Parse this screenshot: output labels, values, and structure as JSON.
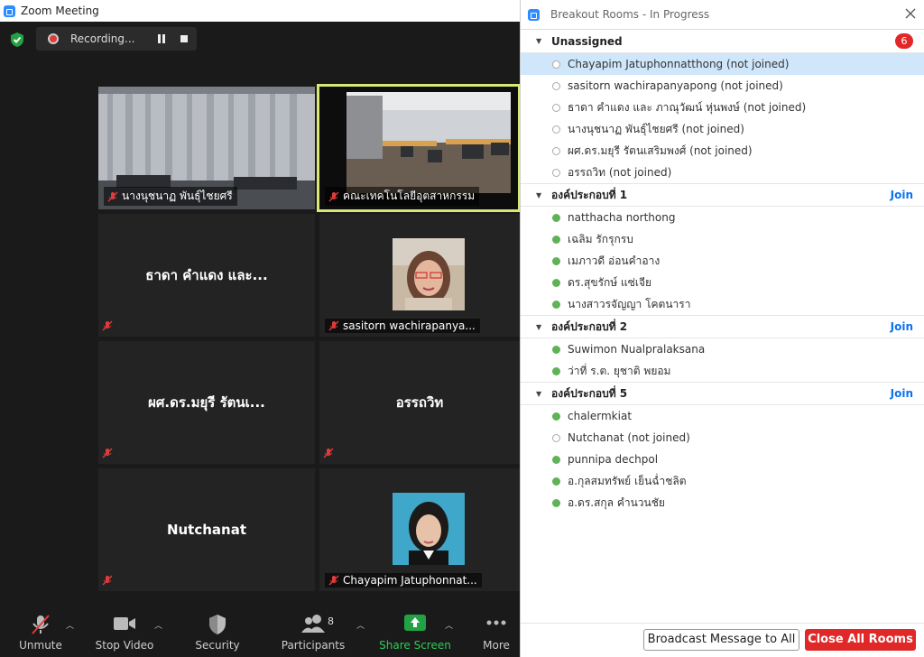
{
  "window": {
    "title": "Zoom Meeting"
  },
  "recording": {
    "label": "Recording..."
  },
  "tiles": [
    {
      "name": "นางนุชนาฏ พันธุ์ไชยศรี",
      "video": "curtain-room"
    },
    {
      "name": "คณะเทคโนโลยีอุตสาหกรรม",
      "video": "classroom",
      "active_speaker": true
    },
    {
      "big": "ธาดา คำแดง และ..."
    },
    {
      "name": "sasitorn wachirapanya...",
      "video": "woman-glasses"
    },
    {
      "big": "ผศ.ดร.มยุรี  รัตนเ..."
    },
    {
      "big": "อรรถวิท"
    },
    {
      "big": "Nutchanat"
    },
    {
      "name": "Chayapim Jatuphonnat...",
      "video": "woman-portrait"
    }
  ],
  "controls": {
    "unmute": "Unmute",
    "stop_video": "Stop Video",
    "security": "Security",
    "participants": "Participants",
    "participants_count": "8",
    "share_screen": "Share Screen",
    "more": "More"
  },
  "panel": {
    "title": "Breakout Rooms - In Progress",
    "join_label": "Join",
    "broadcast": "Broadcast Message to All",
    "close_all": "Close All Rooms",
    "groups": [
      {
        "name": "Unassigned",
        "badge": "6",
        "members": [
          {
            "name": "Chayapim Jatuphonnatthong (not joined)",
            "joined": false,
            "selected": true
          },
          {
            "name": "sasitorn wachirapanyapong (not joined)",
            "joined": false
          },
          {
            "name": "ธาดา คำแดง และ ภาณุวัฒน์ หุ่นพงษ์ (not joined)",
            "joined": false
          },
          {
            "name": "นางนุชนาฏ พันธุ์ไชยศรี (not joined)",
            "joined": false
          },
          {
            "name": "ผศ.ดร.มยุรี  รัตนเสริมพงศ์ (not joined)",
            "joined": false
          },
          {
            "name": "อรรถวิท (not joined)",
            "joined": false
          }
        ]
      },
      {
        "name": "องค์ประกอบที่ 1",
        "members": [
          {
            "name": "natthacha northong",
            "joined": true
          },
          {
            "name": "เฉลิม รักรุกรบ",
            "joined": true
          },
          {
            "name": "เมภาวดี อ่อนคำอาง",
            "joined": true
          },
          {
            "name": "ดร.สุขรักษ์ แซ่เจีย",
            "joined": true
          },
          {
            "name": "นางสาวรจัญญา โคตนารา",
            "joined": true
          }
        ]
      },
      {
        "name": "องค์ประกอบที่ 2",
        "members": [
          {
            "name": "Suwimon Nualpralaksana",
            "joined": true
          },
          {
            "name": "ว่าที่ ร.ต. ยุชาติ พยอม",
            "joined": true
          }
        ]
      },
      {
        "name": "องค์ประกอบที่ 5",
        "members": [
          {
            "name": "chalermkiat",
            "joined": true
          },
          {
            "name": "Nutchanat (not joined)",
            "joined": false
          },
          {
            "name": "punnipa dechpol",
            "joined": true
          },
          {
            "name": "อ.กุลสมทรัพย์ เย็นฉ่ำชลิต",
            "joined": true
          },
          {
            "name": "อ.ดร.สกุล คำนวนชัย",
            "joined": true
          }
        ]
      }
    ]
  }
}
